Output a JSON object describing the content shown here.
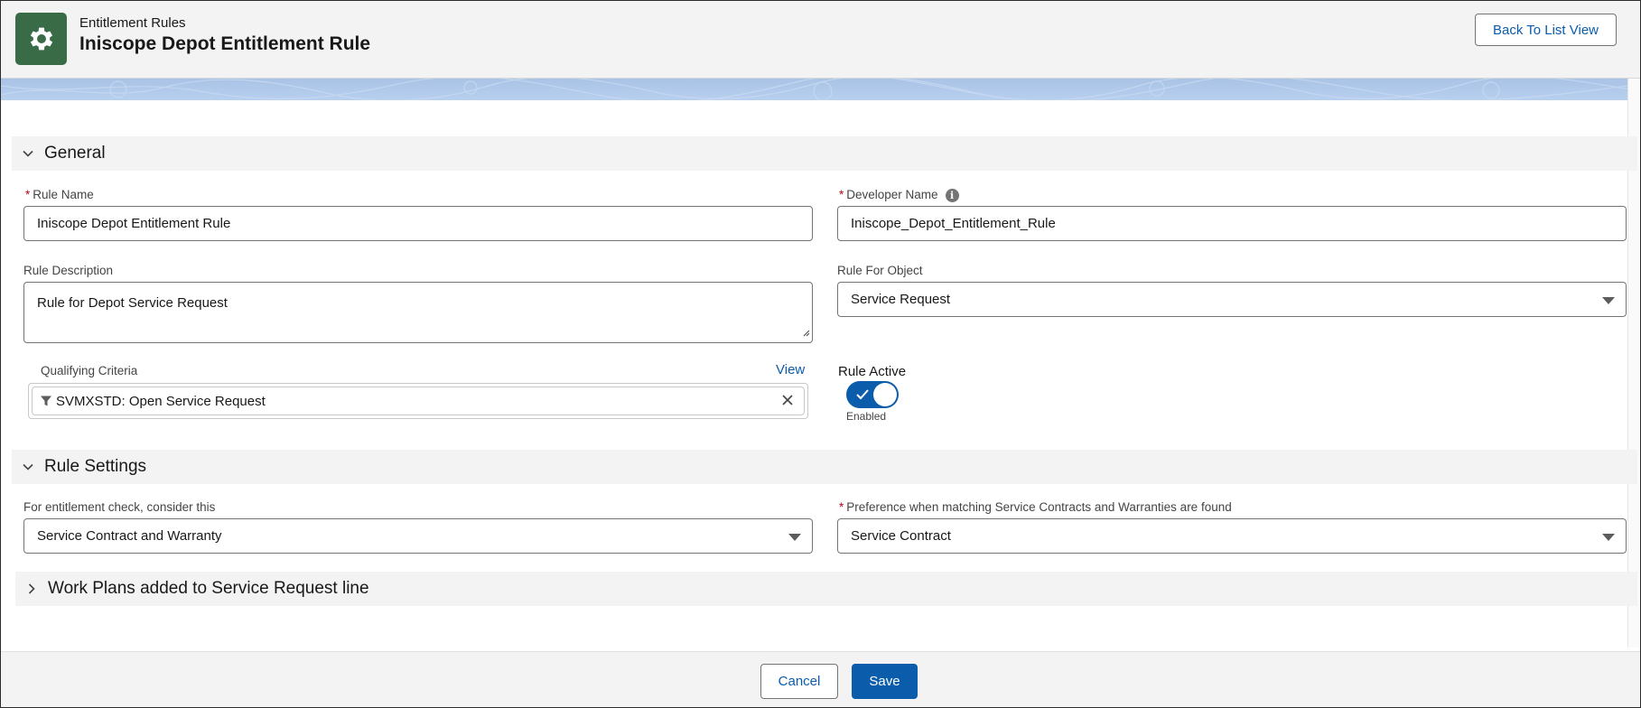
{
  "header": {
    "object_label": "Entitlement Rules",
    "record_title": "Iniscope Depot Entitlement Rule",
    "back_button": "Back To List View",
    "icon": "gear-icon"
  },
  "sections": {
    "general": {
      "title": "General",
      "expanded": true
    },
    "rule_settings": {
      "title": "Rule Settings",
      "expanded": true
    },
    "work_plans": {
      "title": "Work Plans added to Service Request line",
      "expanded": false
    }
  },
  "general": {
    "rule_name": {
      "label": "Rule Name",
      "required": true,
      "value": "Iniscope Depot Entitlement Rule"
    },
    "developer_name": {
      "label": "Developer Name",
      "required": true,
      "value": "Iniscope_Depot_Entitlement_Rule",
      "info_icon": "info-icon"
    },
    "rule_description": {
      "label": "Rule Description",
      "value": "Rule for Depot Service Request"
    },
    "rule_for_object": {
      "label": "Rule For Object",
      "value": "Service Request"
    },
    "qualifying_criteria": {
      "label": "Qualifying Criteria",
      "view_link": "View",
      "value": "SVMXSTD: Open Service Request",
      "icon": "filter-icon"
    },
    "rule_active": {
      "label": "Rule Active",
      "state_text": "Enabled",
      "on": true
    }
  },
  "rule_settings": {
    "entitlement_check": {
      "label": "For entitlement check, consider this",
      "value": "Service Contract and Warranty"
    },
    "preference": {
      "label": "Preference when matching Service Contracts and Warranties are found",
      "required": true,
      "value": "Service Contract"
    }
  },
  "footer": {
    "cancel": "Cancel",
    "save": "Save"
  },
  "colors": {
    "brand_blue": "#0b5cab",
    "icon_green": "#3a6b47",
    "required_red": "#ba0517"
  }
}
